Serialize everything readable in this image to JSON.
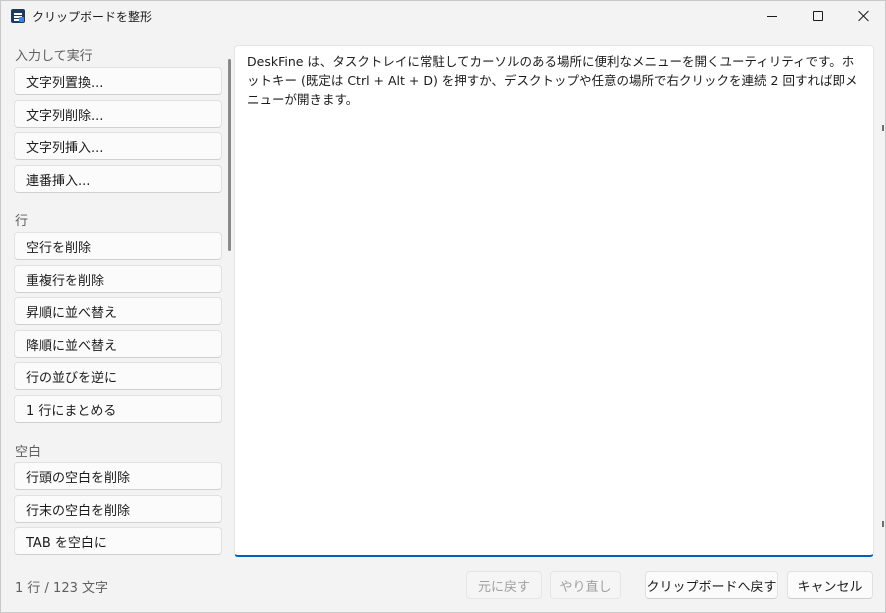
{
  "window": {
    "title": "クリップボードを整形",
    "icons": {
      "app": "clipboard-list-icon",
      "minimize": "minimize-icon",
      "maximize": "maximize-icon",
      "close": "close-icon"
    }
  },
  "sidebar": {
    "sections": [
      {
        "header": "入力して実行",
        "items": [
          "文字列置換...",
          "文字列削除...",
          "文字列挿入...",
          "連番挿入..."
        ]
      },
      {
        "header": "行",
        "items": [
          "空行を削除",
          "重複行を削除",
          "昇順に並べ替え",
          "降順に並べ替え",
          "行の並びを逆に",
          "1 行にまとめる"
        ]
      },
      {
        "header": "空白",
        "items": [
          "行頭の空白を削除",
          "行末の空白を削除",
          "TAB を空白に"
        ]
      }
    ]
  },
  "editor": {
    "content": "DeskFine は、タスクトレイに常駐してカーソルのある場所に便利なメニューを開くユーティリティです。ホットキー (既定は Ctrl + Alt + D) を押すか、デスクトップや任意の場所で右クリックを連続 2 回すれば即メニューが開きます。"
  },
  "status": {
    "text": "1 行 / 123 文字"
  },
  "footer": {
    "undo_label": "元に戻す",
    "redo_label": "やり直し",
    "restore_label": "クリップボードへ戻す",
    "cancel_label": "キャンセル"
  },
  "colors": {
    "accent": "#005fb8",
    "window_bg": "#f3f3f3"
  }
}
